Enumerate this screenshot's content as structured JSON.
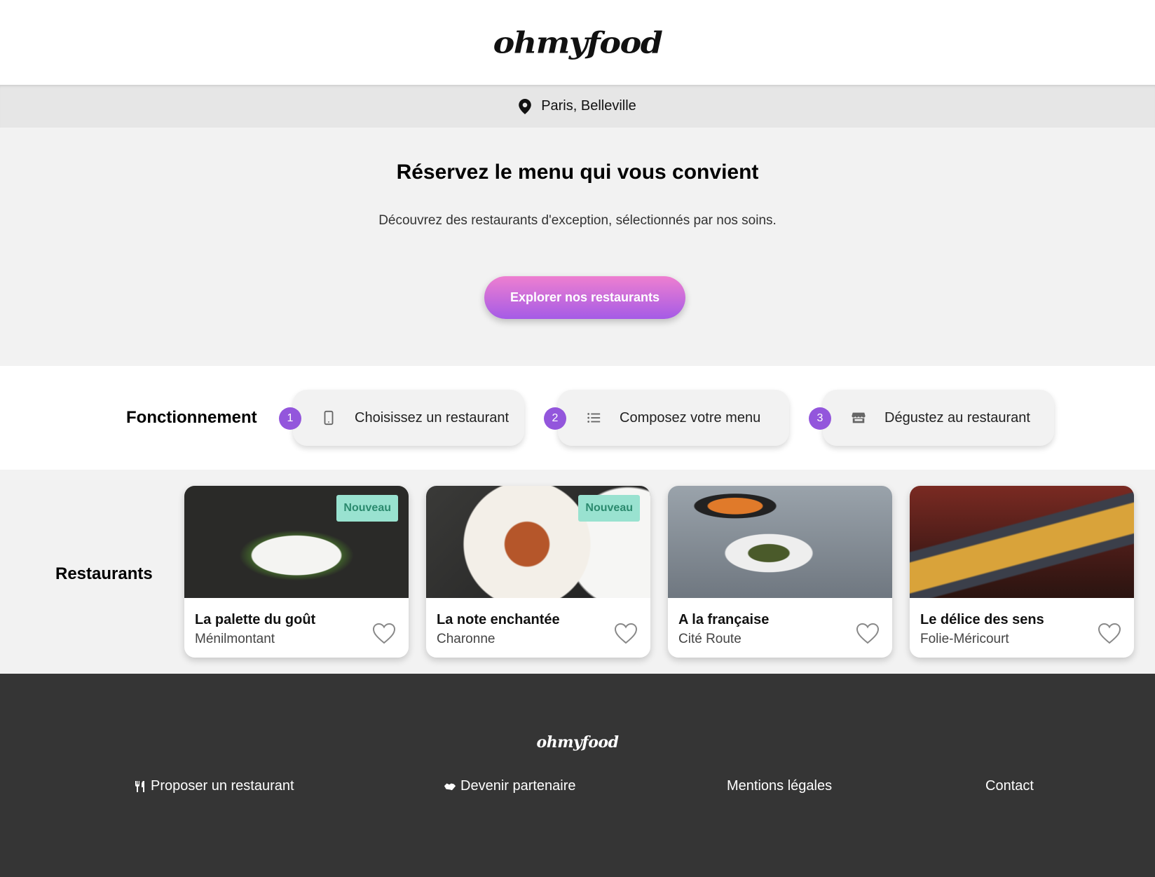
{
  "header": {
    "logo": "ohmyfood"
  },
  "location": {
    "icon": "map-pin-icon",
    "text": "Paris, Belleville"
  },
  "hero": {
    "title": "Réservez le menu qui vous convient",
    "subtitle": "Découvrez des restaurants d'exception, sélectionnés par nos soins.",
    "cta_label": "Explorer nos restaurants"
  },
  "how": {
    "title": "Fonctionnement",
    "steps": [
      {
        "num": "1",
        "icon": "mobile-phone-icon",
        "label": "Choisissez un restaurant"
      },
      {
        "num": "2",
        "icon": "list-icon",
        "label": "Composez votre menu"
      },
      {
        "num": "3",
        "icon": "store-icon",
        "label": "Dégustez au restaurant"
      }
    ]
  },
  "restaurants": {
    "title": "Restaurants",
    "items": [
      {
        "name": "La palette du goût",
        "area": "Ménilmontant",
        "badge": "Nouveau"
      },
      {
        "name": "La note enchantée",
        "area": "Charonne",
        "badge": "Nouveau"
      },
      {
        "name": "A la française",
        "area": "Cité Route",
        "badge": ""
      },
      {
        "name": "Le délice des sens",
        "area": "Folie-Méricourt",
        "badge": ""
      }
    ]
  },
  "footer": {
    "logo": "ohmyfood",
    "links": [
      {
        "icon": "utensils-icon",
        "label": "Proposer un restaurant"
      },
      {
        "icon": "handshake-icon",
        "label": "Devenir partenaire"
      },
      {
        "icon": "",
        "label": "Mentions légales"
      },
      {
        "icon": "",
        "label": "Contact"
      }
    ]
  },
  "colors": {
    "accent_purple": "#9356dc",
    "cta_gradient_top": "#ee7fd0",
    "cta_gradient_bottom": "#a55be6",
    "badge_bg": "#99e2d0",
    "badge_text": "#2b8a6e",
    "footer_bg": "#353535"
  }
}
